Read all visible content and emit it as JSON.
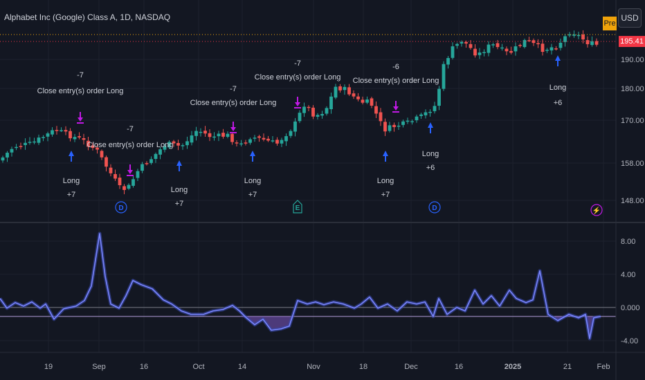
{
  "header": {
    "symbol_title": "Alphabet Inc (Google) Class A, 1D, NASDAQ",
    "currency_button": "USD",
    "session_badge": "Pre",
    "last_price": "195.41"
  },
  "colors": {
    "background": "#131722",
    "up": "#26a69a",
    "down": "#ef5350",
    "signal": "#2962ff",
    "exit": "#c119e6",
    "oscillator": "#7b86ff"
  },
  "price_axis_labels": [
    "190.00",
    "180.00",
    "170.00",
    "158.00",
    "148.00"
  ],
  "osc_axis_labels": [
    "8.00",
    "4.00",
    "0.000",
    "-4.00"
  ],
  "time_axis_labels": [
    "19",
    "Sep",
    "16",
    "Oct",
    "14",
    "Nov",
    "18",
    "Dec",
    "16",
    "2025",
    "21",
    "Feb"
  ],
  "chart_data": {
    "type": "candlestick",
    "x_axis": [
      "19",
      "Sep",
      "16",
      "Oct",
      "14",
      "Nov",
      "18",
      "Dec",
      "16",
      "2025",
      "21",
      "Feb"
    ],
    "price_axis_ticks": [
      148,
      158,
      170,
      180,
      190
    ],
    "last_price": 195.41,
    "trade_annotations": [
      {
        "side": "long",
        "entry_label": "Long",
        "qty_label": "+7",
        "close_label": "Close entry(s) order Long",
        "close_qty": "-7"
      },
      {
        "side": "long",
        "entry_label": "Long",
        "qty_label": "+7",
        "close_label": "Close entry(s) order Long",
        "close_qty": "-7"
      },
      {
        "side": "long",
        "entry_label": "Long",
        "qty_label": "+7",
        "close_label": "Close entry(s) order Long",
        "close_qty": "-7"
      },
      {
        "side": "long",
        "entry_label": "Long",
        "qty_label": "+7",
        "close_label": "Close entry(s) order Long",
        "close_qty": "-7"
      },
      {
        "side": "long",
        "entry_label": "Long",
        "qty_label": "+6",
        "close_label": "Close entry(s) order Long",
        "close_qty": "-6"
      },
      {
        "side": "long",
        "entry_label": "Long",
        "qty_label": "+6"
      }
    ],
    "event_markers": [
      "D",
      "E",
      "D",
      "⚡"
    ],
    "oscillator": {
      "axis_ticks": [
        -4,
        0,
        4,
        8
      ]
    }
  }
}
